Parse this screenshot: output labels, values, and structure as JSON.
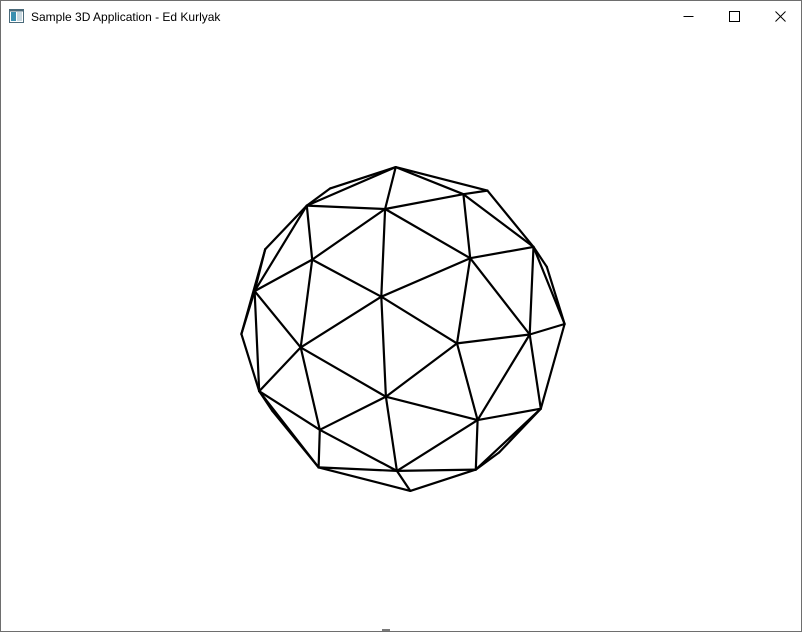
{
  "window": {
    "title": "Sample 3D Application - Ed Kurlyak",
    "buttons": {
      "minimize_icon": "minimize-icon",
      "maximize_icon": "maximize-icon",
      "close_icon": "close-icon"
    }
  },
  "scene": {
    "object": "wireframe-sphere",
    "background_color": "#ffffff",
    "line_color": "#000000"
  }
}
